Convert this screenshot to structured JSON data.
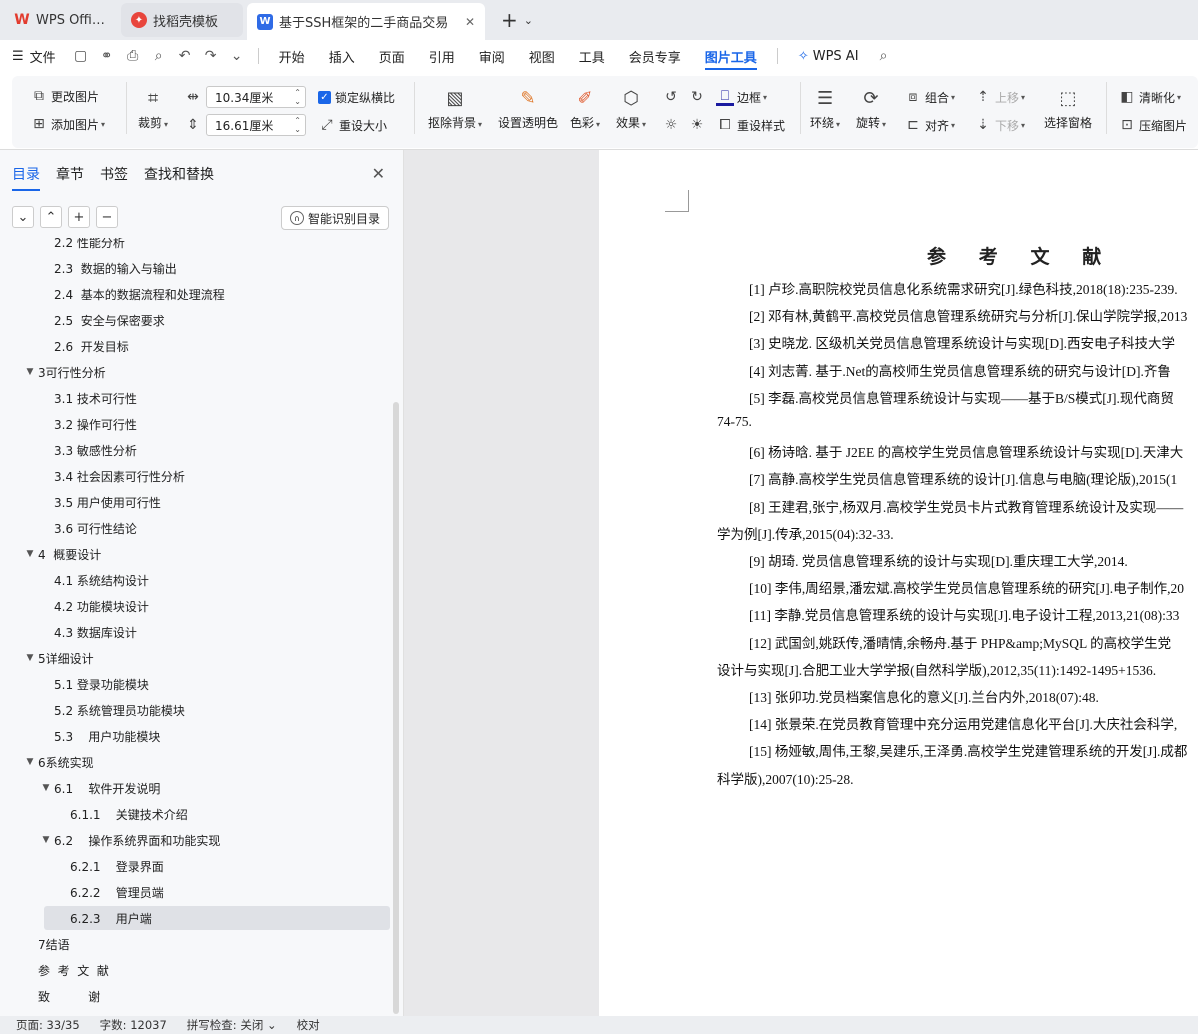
{
  "tabs": [
    {
      "label": "WPS Office",
      "icon": "wps-logo-icon"
    },
    {
      "label": "找稻壳模板",
      "icon": "daoke-icon"
    },
    {
      "label": "基于SSH框架的二手商品交易",
      "icon": "wps-writer-icon"
    }
  ],
  "menu": {
    "file": "文件",
    "items": [
      "开始",
      "插入",
      "页面",
      "引用",
      "审阅",
      "视图",
      "工具",
      "会员专享",
      "图片工具"
    ],
    "active": "图片工具",
    "wps_ai": "WPS AI"
  },
  "ribbon": {
    "change_image": "更改图片",
    "add_image": "添加图片",
    "crop": "裁剪",
    "width_value": "10.34厘米",
    "height_value": "16.61厘米",
    "lock_ratio": "锁定纵横比",
    "reset_size": "重设大小",
    "remove_bg": "抠除背景",
    "set_transparent": "设置透明色",
    "color": "色彩",
    "effects": "效果",
    "border": "边框",
    "reset_style": "重设样式",
    "wrap": "环绕",
    "rotate": "旋转",
    "group": "组合",
    "align": "对齐",
    "move_up": "上移",
    "move_down": "下移",
    "selection_pane": "选择窗格",
    "sharpen": "清晰化",
    "compress": "压缩图片"
  },
  "nav": {
    "tabs": [
      "目录",
      "章节",
      "书签",
      "查找和替换"
    ],
    "smart_toc": "智能识别目录",
    "items": [
      {
        "label": "2.2 性能分析",
        "level": 2,
        "toggle": ""
      },
      {
        "label": "2.3  数据的输入与输出",
        "level": 2,
        "toggle": ""
      },
      {
        "label": "2.4  基本的数据流程和处理流程",
        "level": 2,
        "toggle": ""
      },
      {
        "label": "2.5  安全与保密要求",
        "level": 2,
        "toggle": ""
      },
      {
        "label": "2.6  开发目标",
        "level": 2,
        "toggle": ""
      },
      {
        "label": "3可行性分析",
        "level": 1,
        "toggle": "▼"
      },
      {
        "label": "3.1 技术可行性",
        "level": 2,
        "toggle": ""
      },
      {
        "label": "3.2 操作可行性",
        "level": 2,
        "toggle": ""
      },
      {
        "label": "3.3 敏感性分析",
        "level": 2,
        "toggle": ""
      },
      {
        "label": "3.4 社会因素可行性分析",
        "level": 2,
        "toggle": ""
      },
      {
        "label": "3.5 用户使用可行性",
        "level": 2,
        "toggle": ""
      },
      {
        "label": "3.6 可行性结论",
        "level": 2,
        "toggle": ""
      },
      {
        "label": "4  概要设计",
        "level": 1,
        "toggle": "▼"
      },
      {
        "label": "4.1 系统结构设计",
        "level": 2,
        "toggle": ""
      },
      {
        "label": "4.2 功能模块设计",
        "level": 2,
        "toggle": ""
      },
      {
        "label": "4.3 数据库设计",
        "level": 2,
        "toggle": ""
      },
      {
        "label": "5详细设计",
        "level": 1,
        "toggle": "▼"
      },
      {
        "label": "5.1 登录功能模块",
        "level": 2,
        "toggle": ""
      },
      {
        "label": "5.2 系统管理员功能模块",
        "level": 2,
        "toggle": ""
      },
      {
        "label": "5.3    用户功能模块",
        "level": 2,
        "toggle": ""
      },
      {
        "label": "6系统实现",
        "level": 1,
        "toggle": "▼"
      },
      {
        "label": "6.1    软件开发说明",
        "level": 2,
        "toggle": "▼"
      },
      {
        "label": "6.1.1    关键技术介绍",
        "level": 3,
        "toggle": ""
      },
      {
        "label": "6.2    操作系统界面和功能实现",
        "level": 2,
        "toggle": "▼"
      },
      {
        "label": "6.2.1    登录界面",
        "level": 3,
        "toggle": ""
      },
      {
        "label": "6.2.2    管理员端",
        "level": 3,
        "toggle": ""
      },
      {
        "label": "6.2.3    用户端",
        "level": 3,
        "toggle": "",
        "selected": true
      },
      {
        "label": "7结语",
        "level": 1,
        "toggle": ""
      },
      {
        "label": "参  考  文  献",
        "level": 1,
        "toggle": ""
      },
      {
        "label": "致          谢",
        "level": 1,
        "toggle": ""
      }
    ]
  },
  "document": {
    "title": "参 考 文 献",
    "lines": [
      {
        "text": "[1] 卢珍.高职院校党员信息化系统需求研究[J].绿色科技,2018(18):235-239.",
        "indent": true
      },
      {
        "text": "[2] 邓有林,黄鹤平.高校党员信息管理系统研究与分析[J].保山学院学报,2013",
        "indent": true
      },
      {
        "text": "[3] 史晓龙. 区级机关党员信息管理系统设计与实现[D].西安电子科技大学",
        "indent": true
      },
      {
        "text": "[4] 刘志菁. 基于.Net的高校师生党员信息管理系统的研究与设计[D].齐鲁",
        "indent": true
      },
      {
        "text": "[5] 李磊.高校党员信息管理系统设计与实现——基于B/S模式[J].现代商贸",
        "indent": true
      },
      {
        "text": "74-75.",
        "indent": false
      },
      {
        "text": "[6] 杨诗晗. 基于 J2EE 的高校学生党员信息管理系统设计与实现[D].天津大",
        "indent": true
      },
      {
        "text": "[7] 高静.高校学生党员信息管理系统的设计[J].信息与电脑(理论版),2015(1",
        "indent": true
      },
      {
        "text": "[8] 王建君,张宁,杨双月.高校学生党员卡片式教育管理系统设计及实现——",
        "indent": true
      },
      {
        "text": "学为例[J].传承,2015(04):32-33.",
        "indent": false
      },
      {
        "text": "[9] 胡琦. 党员信息管理系统的设计与实现[D].重庆理工大学,2014.",
        "indent": true
      },
      {
        "text": "[10] 李伟,周绍景,潘宏斌.高校学生党员信息管理系统的研究[J].电子制作,20",
        "indent": true
      },
      {
        "text": "[11] 李静.党员信息管理系统的设计与实现[J].电子设计工程,2013,21(08):33",
        "indent": true
      },
      {
        "text": "[12] 武国剑,姚跃传,潘晴情,余畅舟.基于 PHP&amp;MySQL 的高校学生党",
        "indent": true
      },
      {
        "text": "设计与实现[J].合肥工业大学学报(自然科学版),2012,35(11):1492-1495+1536.",
        "indent": false
      },
      {
        "text": "[13] 张卯功.党员档案信息化的意义[J].兰台内外,2018(07):48.",
        "indent": true
      },
      {
        "text": "[14] 张景荣.在党员教育管理中充分运用党建信息化平台[J].大庆社会科学,",
        "indent": true
      },
      {
        "text": "[15] 杨娅敏,周伟,王黎,吴建乐,王泽勇.高校学生党建管理系统的开发[J].成都",
        "indent": true
      },
      {
        "text": "科学版),2007(10):25-28.",
        "indent": false
      }
    ]
  },
  "status": {
    "page": "页面: 33/35",
    "words": "字数: 12037",
    "spell": "拼写检查: 关闭",
    "proof": "校对"
  },
  "colors": {
    "accent": "#1a66e8",
    "wps_red": "#e23b2e"
  }
}
